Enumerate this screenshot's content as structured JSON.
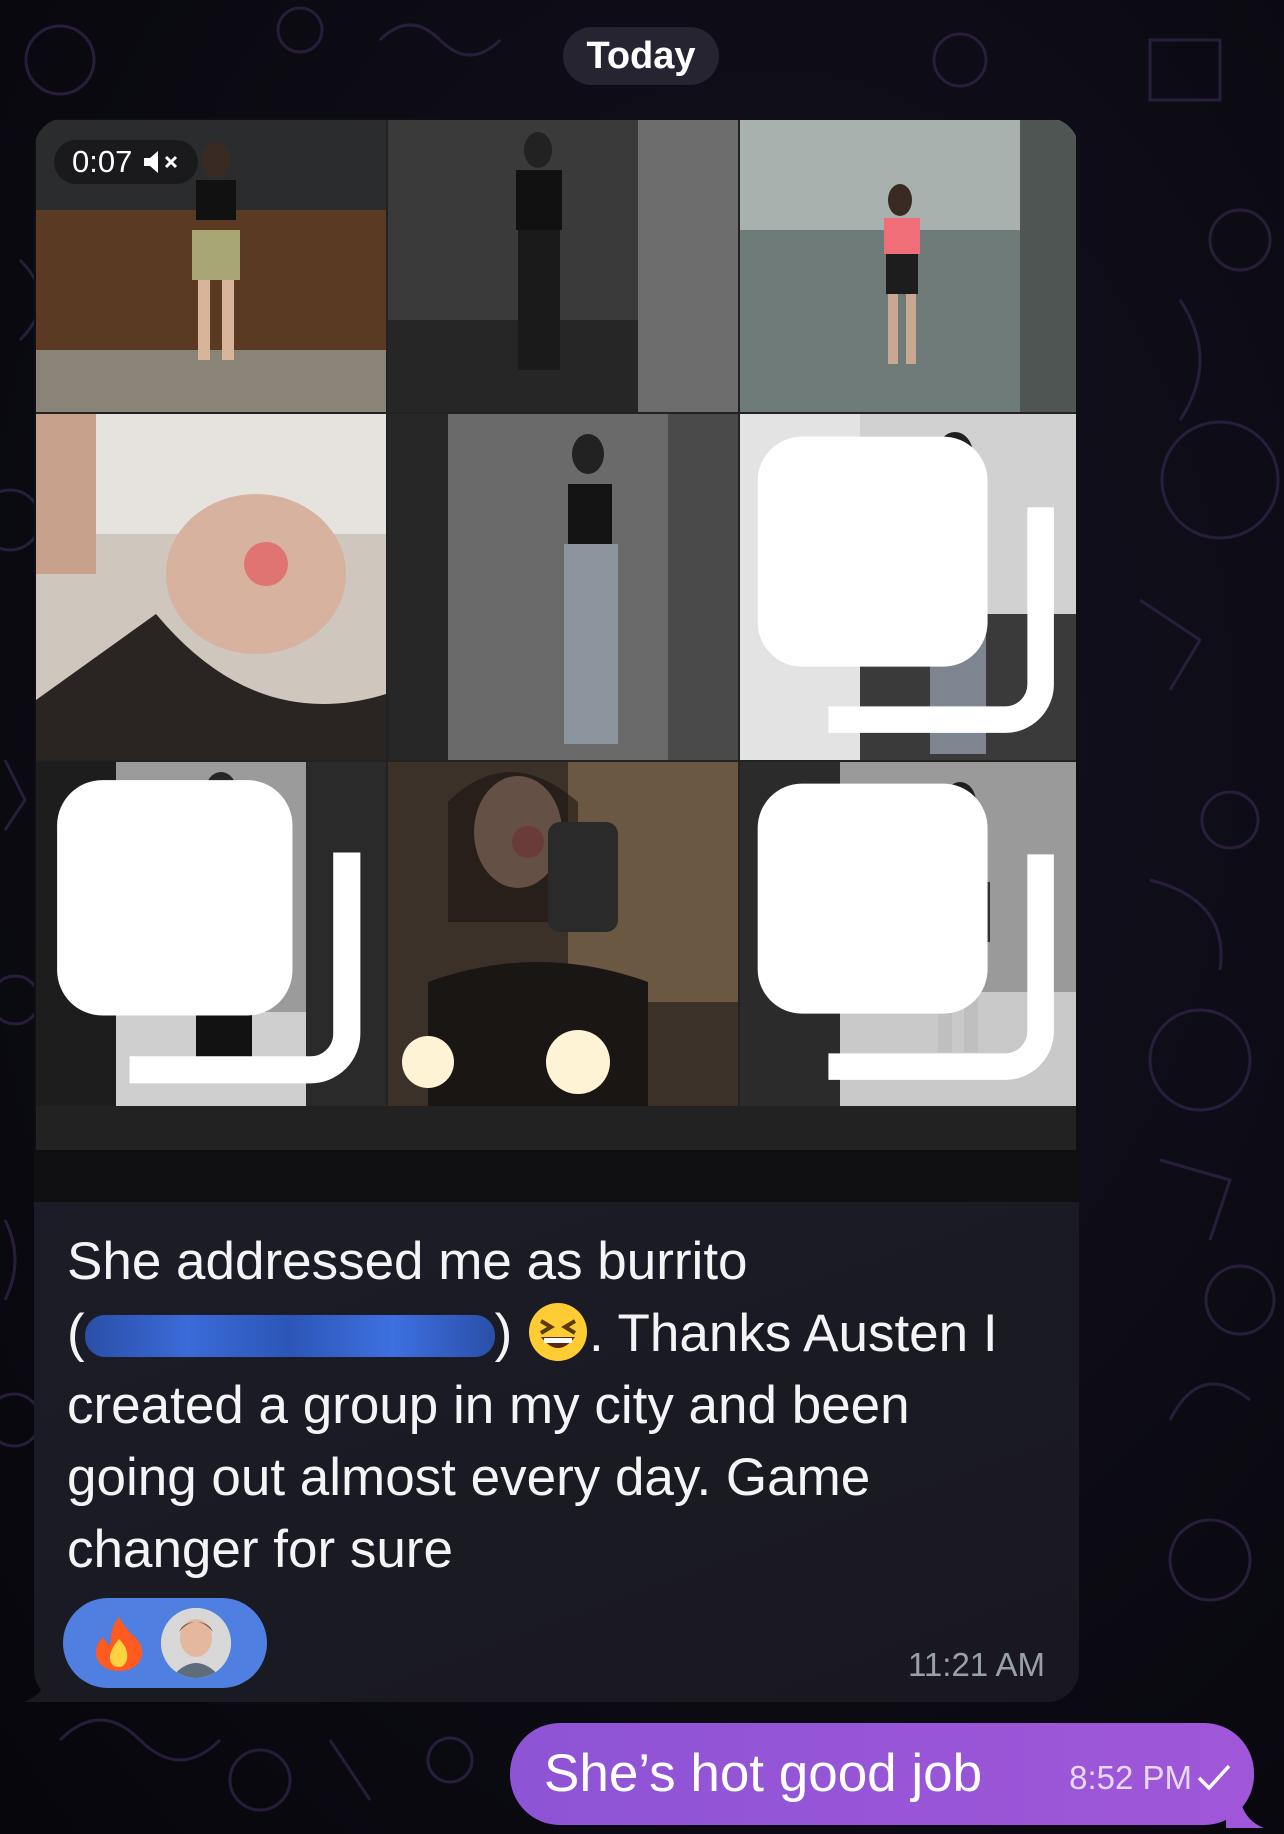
{
  "chat": {
    "date_separator": "Today"
  },
  "incoming_message": {
    "video_timer": "0:07",
    "muted_icon": "speaker-muted-icon",
    "text_line1": "She addressed me as burrito",
    "text_open_paren": "(",
    "text_line2_rest": ") ",
    "text_line2_after_emoji": ". Thanks Austen I",
    "text_line3": "created a group in my city and been",
    "text_line4": "going out almost every day. Game",
    "text_line5": "changer for sure",
    "emoji": "grinning-squinting-face-emoji",
    "reaction_icon": "fire-emoji",
    "reaction_user": "avatar",
    "time": "11:21 AM"
  },
  "outgoing_message": {
    "text": "She’s hot good job",
    "time": "8:52 PM",
    "status_icon": "checkmark-icon"
  },
  "colors": {
    "incoming_bubble": "#1c1f2b",
    "outgoing_bubble": "#9755d7",
    "reaction_pill": "#4f7fe0",
    "redaction": "#3565cc"
  }
}
